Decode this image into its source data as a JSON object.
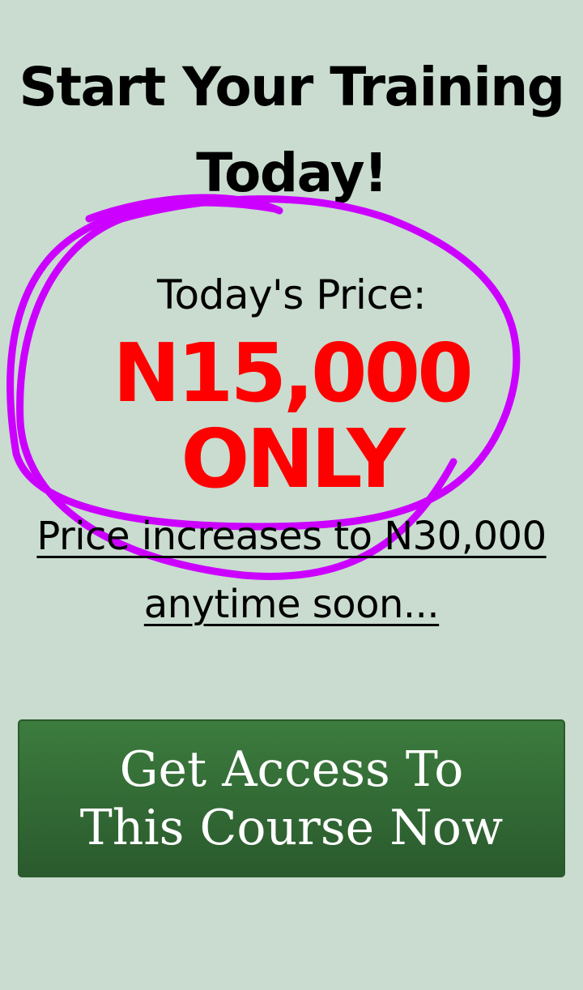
{
  "headline": "Start Your Training Today!",
  "price": {
    "label": "Today's Price:",
    "amount_line1": "N15,000",
    "amount_line2": "ONLY",
    "note": "Price increases to N30,000 anytime soon..."
  },
  "cta": {
    "label": "Get Access To This Course Now"
  },
  "colors": {
    "background": "#c9dccf",
    "price": "#ff0000",
    "highlight_circle": "#cc00ff",
    "button": "#336b35"
  }
}
